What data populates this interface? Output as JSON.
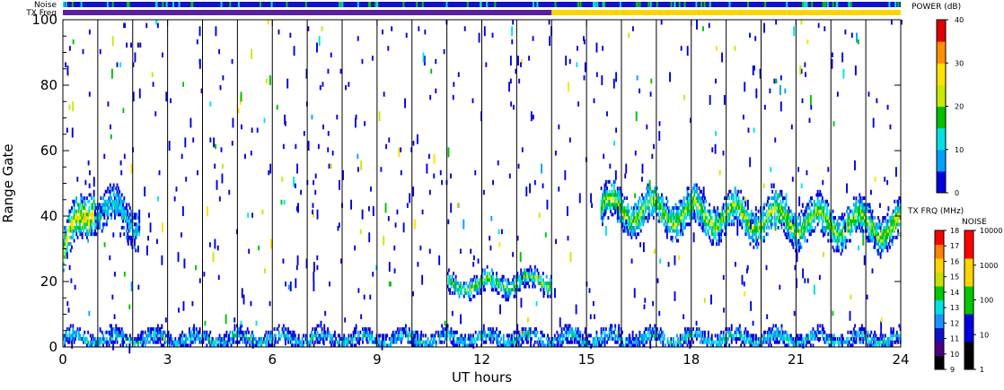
{
  "chart_data": {
    "type": "heatmap",
    "title": "",
    "xlabel": "UT hours",
    "ylabel": "Range Gate",
    "xlim": [
      0,
      24
    ],
    "ylim": [
      0,
      100
    ],
    "xticks": [
      "0",
      "3",
      "6",
      "9",
      "12",
      "15",
      "18",
      "21",
      "24"
    ],
    "yticks": [
      "0",
      "20",
      "40",
      "60",
      "80",
      "100"
    ],
    "scan_boundaries_hours": [
      1,
      2,
      3,
      4,
      5,
      6,
      7,
      8,
      9,
      10,
      11,
      12,
      13,
      14,
      15,
      16,
      17,
      18,
      19,
      20,
      21,
      22,
      23
    ],
    "status_bars": {
      "noise_label": "Noise",
      "freq_label": "TX Freq",
      "freq_switch_hour": 14,
      "freq_before_color": "#5a1ea0",
      "freq_after_color": "#ffd400"
    },
    "backscatter_regions": [
      {
        "name": "early-echo",
        "x": [
          0.0,
          0.9
        ],
        "gate_center": [
          28,
          45
        ],
        "gate_width": 12,
        "power_db": 22
      },
      {
        "name": "early-tail",
        "x": [
          0.9,
          2.2
        ],
        "gate_center": [
          42,
          38
        ],
        "gate_width": 10,
        "power_db": 10
      },
      {
        "name": "midday-patch",
        "x": [
          11.0,
          14.0
        ],
        "gate_center": [
          18,
          20
        ],
        "gate_width": 5,
        "power_db": 16
      },
      {
        "name": "afternoon-band",
        "x": [
          15.4,
          24.0
        ],
        "gate_center": [
          42,
          36
        ],
        "gate_width": 10,
        "power_db": 18
      },
      {
        "name": "ground-scatter",
        "x": [
          0.0,
          24.0
        ],
        "gate_center": [
          2,
          2
        ],
        "gate_width": 4,
        "power_db": 10
      }
    ],
    "power_colorbar": {
      "title": "POWER (dB)",
      "range": [
        0,
        40
      ],
      "ticks": [
        "0",
        "10",
        "20",
        "30",
        "40"
      ],
      "colors": [
        "#0000e0",
        "#00a0ff",
        "#00e0e0",
        "#00c000",
        "#c8e800",
        "#ffe000",
        "#ff9000",
        "#e00000"
      ]
    },
    "freq_colorbar": {
      "title": "TX FRQ (MHz)",
      "ticks": [
        "9",
        "10",
        "11",
        "12",
        "13",
        "14",
        "15",
        "16",
        "17",
        "18"
      ],
      "colors": [
        "#000000",
        "#4b0082",
        "#1010c8",
        "#1e90ff",
        "#00e0e0",
        "#00c800",
        "#c8e000",
        "#ffd400",
        "#ff8000",
        "#ff0000"
      ]
    },
    "noise_colorbar": {
      "title": "NOISE",
      "ticks": [
        "1",
        "10",
        "100",
        "1000",
        "10000"
      ],
      "colors": [
        "#000000",
        "#0000e0",
        "#00c800",
        "#ffd400",
        "#ff0000"
      ]
    }
  }
}
